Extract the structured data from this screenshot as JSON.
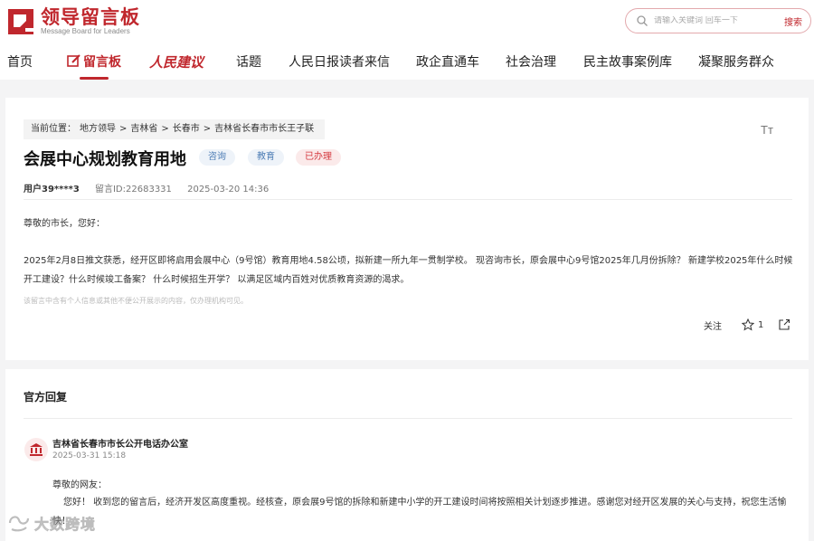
{
  "header": {
    "logo_title": "领导留言板",
    "logo_subtitle": "Message Board for Leaders",
    "search_placeholder": "请输入关键词 回车一下",
    "search_button": "搜索"
  },
  "nav": {
    "items": [
      "首页",
      "留言板",
      "人民建议",
      "话题",
      "人民日报读者来信",
      "政企直通车",
      "社会治理",
      "民主故事案例库",
      "凝聚服务群众"
    ],
    "active_index": 1
  },
  "message": {
    "breadcrumb_prefix": "当前位置：",
    "breadcrumb": [
      "地方领导",
      "吉林省",
      "长春市",
      "吉林省长春市市长王子联"
    ],
    "breadcrumb_sep": ">",
    "font_toggle": "Tт",
    "title": "会展中心规划教育用地",
    "tags": [
      "咨询",
      "教育",
      "已办理"
    ],
    "user": "用户39****3",
    "message_id": "留言ID:22683331",
    "date": "2025-03-20 14:36",
    "greeting": "尊敬的市长，您好：",
    "body": "2025年2月8日推文获悉，经开区即将启用会展中心（9号馆）教育用地4.58公顷，拟新建一所九年一贯制学校。 现咨询市长，原会展中心9号馆2025年几月份拆除？ 新建学校2025年什么时候开工建设？什么时候竣工备案？ 什么时候招生开学？ 以满足区域内百姓对优质教育资源的渴求。",
    "privacy_note": "该留言中含有个人信息或其他不便公开展示的内容，仅办理机构可见。",
    "follow_label": "关注",
    "star_count": "1"
  },
  "reply": {
    "heading": "官方回复",
    "org_name": "吉林省长春市市长公开电话办公室",
    "time": "2025-03-31 15:18",
    "greeting": "尊敬的网友：",
    "body": "您好！ 收到您的留言后，经济开发区高度重视。经核查，原会展9号馆的拆除和新建中小学的开工建设时间将按照相关计划逐步推进。感谢您对经开区发展的关心与支持，祝您生活愉快！"
  },
  "watermark": "大数跨境",
  "colors": {
    "brand_red": "#c0272d",
    "tag_blue": "#4d7db5",
    "tag_red": "#d4383e"
  }
}
